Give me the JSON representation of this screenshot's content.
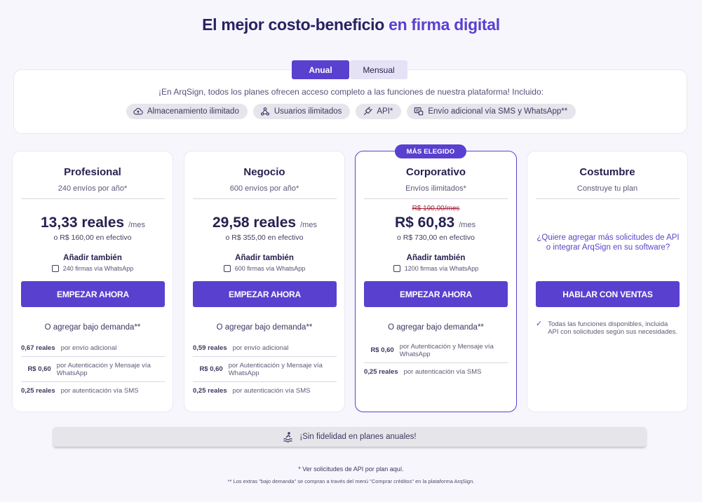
{
  "header": {
    "title_main": "El mejor costo-beneficio",
    "title_accent": "en firma digital"
  },
  "billing_toggle": {
    "annual": "Anual",
    "monthly": "Mensual"
  },
  "info": {
    "text": "¡En ArqSign, todos los planes ofrecen acceso completo a las funciones de nuestra plataforma! Incluido:",
    "chips": [
      {
        "icon": "cloud-upload-icon",
        "label": "Almacenamiento ilimitado"
      },
      {
        "icon": "users-network-icon",
        "label": "Usuarios ilimitados"
      },
      {
        "icon": "plug-icon",
        "label": "API*"
      },
      {
        "icon": "message-screen-icon",
        "label": "Envío adicional vía SMS y WhatsApp**"
      }
    ]
  },
  "plans": [
    {
      "name": "Profesional",
      "subtitle": "240 envíos por año*",
      "price": "13,33 reales",
      "per": "/mes",
      "cash": "o R$ 160,00 en efectivo",
      "add_title": "Añadir también",
      "add_option": "240 firmas vía WhatsApp",
      "cta": "EMPEZAR AHORA",
      "ondemand_title": "O agregar bajo demanda**",
      "ondemand": [
        {
          "value": "0,67 reales",
          "desc": "por envío adicional"
        },
        {
          "value": "R$ 0,60",
          "desc": "por Autenticación y Mensaje vía WhatsApp"
        },
        {
          "value": "0,25 reales",
          "desc": "por autenticación vía SMS"
        }
      ]
    },
    {
      "name": "Negocio",
      "subtitle": "600 envíos por año*",
      "price": "29,58 reales",
      "per": "/mes",
      "cash": "o R$ 355,00 en efectivo",
      "add_title": "Añadir también",
      "add_option": "600 firmas vía WhatsApp",
      "cta": "EMPEZAR AHORA",
      "ondemand_title": "O agregar bajo demanda**",
      "ondemand": [
        {
          "value": "0,59 reales",
          "desc": "por envío adicional"
        },
        {
          "value": "R$ 0,60",
          "desc": "por Autenticación y Mensaje vía WhatsApp"
        },
        {
          "value": "0,25 reales",
          "desc": "por autenticación vía SMS"
        }
      ]
    },
    {
      "badge": "MÁS ELEGIDO",
      "name": "Corporativo",
      "subtitle": "Envíos ilimitados*",
      "old_price": "R$ 190,00/mes",
      "price": "R$ 60,83",
      "per": "/mes",
      "cash": "o R$ 730,00 en efectivo",
      "add_title": "Añadir también",
      "add_option": "1200 firmas vía WhatsApp",
      "cta": "EMPEZAR AHORA",
      "ondemand_title": "O agregar bajo demanda**",
      "ondemand": [
        {
          "value": "R$ 0,60",
          "desc": "por Autenticación y Mensaje vía WhatsApp"
        },
        {
          "value": "0,25 reales",
          "desc": "por autenticación vía SMS"
        }
      ]
    },
    {
      "name": "Costumbre",
      "subtitle": "Construye tu plan",
      "question": "¿Quiere agregar más solicitudes de API o integrar ArqSign en su software?",
      "cta": "HABLAR CON VENTAS",
      "feature": "Todas las funciones disponibles, incluida API con solicitudes según sus necesidades."
    }
  ],
  "banner": {
    "icon": "wave-person-icon",
    "text": "¡Sin fidelidad en planes anuales!"
  },
  "footer": {
    "note1": "* Ver solicitudes de API por plan aquí.",
    "note2": "** Los extras \"bajo demanda\" se compran a través del menú \"Comprar créditos\" en la plataforma ArqSign."
  }
}
